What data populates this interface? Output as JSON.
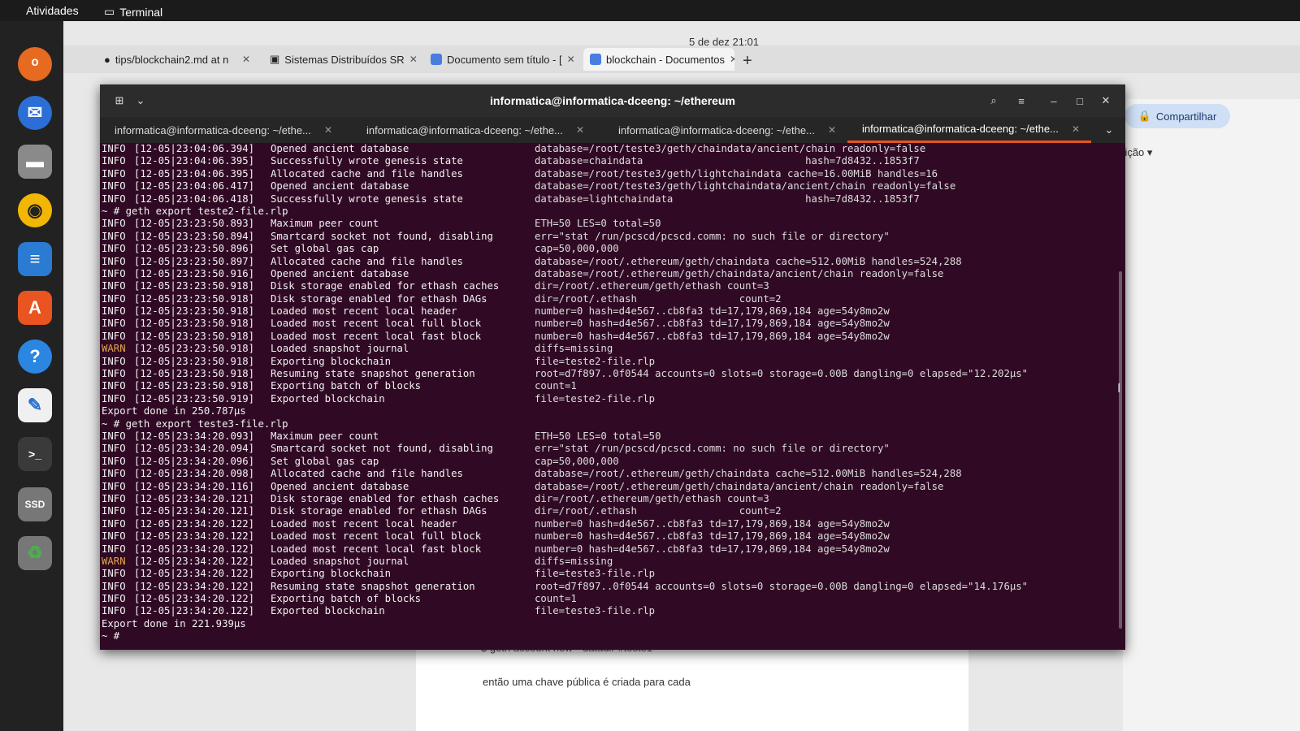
{
  "topbar": {
    "activities": "Atividades",
    "app": "Terminal",
    "clock": "5 de dez  21:01"
  },
  "browser": {
    "tabs": [
      {
        "label": "tips/blockchain2.md at n",
        "active": false
      },
      {
        "label": "Sistemas Distribuídos SR",
        "active": false
      },
      {
        "label": "Documento sem título - [",
        "active": false
      },
      {
        "label": "blockchain - Documentos",
        "active": true
      }
    ],
    "share_label": "Compartilhar",
    "edit_label": "Edição",
    "doc_line1": "$ geth account new --datadir ./teste1",
    "doc_line2": "então uma chave pública é criada para cada"
  },
  "terminal": {
    "title": "informatica@informatica-dceeng: ~/ethereum",
    "tabs": [
      {
        "label": "informatica@informatica-dceeng: ~/ethe...",
        "active": false
      },
      {
        "label": "informatica@informatica-dceeng: ~/ethe...",
        "active": false
      },
      {
        "label": "informatica@informatica-dceeng: ~/ethe...",
        "active": false
      },
      {
        "label": "informatica@informatica-dceeng: ~/ethe...",
        "active": true
      }
    ],
    "lines": [
      {
        "lvl": "INFO",
        "ts": "[12-05|23:04:06.394]",
        "msg": "Opened ancient database",
        "ctx": "database=/root/teste3/geth/chaindata/ancient/chain readonly=false"
      },
      {
        "lvl": "INFO",
        "ts": "[12-05|23:04:06.395]",
        "msg": "Successfully wrote genesis state",
        "ctx": "database=chaindata                           hash=7d8432..1853f7"
      },
      {
        "lvl": "INFO",
        "ts": "[12-05|23:04:06.395]",
        "msg": "Allocated cache and file handles",
        "ctx": "database=/root/teste3/geth/lightchaindata cache=16.00MiB handles=16"
      },
      {
        "lvl": "INFO",
        "ts": "[12-05|23:04:06.417]",
        "msg": "Opened ancient database",
        "ctx": "database=/root/teste3/geth/lightchaindata/ancient/chain readonly=false"
      },
      {
        "lvl": "INFO",
        "ts": "[12-05|23:04:06.418]",
        "msg": "Successfully wrote genesis state",
        "ctx": "database=lightchaindata                      hash=7d8432..1853f7"
      },
      {
        "plain": "~ # geth export teste2-file.rlp"
      },
      {
        "lvl": "INFO",
        "ts": "[12-05|23:23:50.893]",
        "msg": "Maximum peer count",
        "ctx": "ETH=50 LES=0 total=50"
      },
      {
        "lvl": "INFO",
        "ts": "[12-05|23:23:50.894]",
        "msg": "Smartcard socket not found, disabling",
        "ctx": "err=\"stat /run/pcscd/pcscd.comm: no such file or directory\""
      },
      {
        "lvl": "INFO",
        "ts": "[12-05|23:23:50.896]",
        "msg": "Set global gas cap",
        "ctx": "cap=50,000,000"
      },
      {
        "lvl": "INFO",
        "ts": "[12-05|23:23:50.897]",
        "msg": "Allocated cache and file handles",
        "ctx": "database=/root/.ethereum/geth/chaindata cache=512.00MiB handles=524,288"
      },
      {
        "lvl": "INFO",
        "ts": "[12-05|23:23:50.916]",
        "msg": "Opened ancient database",
        "ctx": "database=/root/.ethereum/geth/chaindata/ancient/chain readonly=false"
      },
      {
        "lvl": "INFO",
        "ts": "[12-05|23:23:50.918]",
        "msg": "Disk storage enabled for ethash caches",
        "ctx": "dir=/root/.ethereum/geth/ethash count=3"
      },
      {
        "lvl": "INFO",
        "ts": "[12-05|23:23:50.918]",
        "msg": "Disk storage enabled for ethash DAGs",
        "ctx": "dir=/root/.ethash                 count=2"
      },
      {
        "lvl": "INFO",
        "ts": "[12-05|23:23:50.918]",
        "msg": "Loaded most recent local header",
        "ctx": "number=0 hash=d4e567..cb8fa3 td=17,179,869,184 age=54y8mo2w"
      },
      {
        "lvl": "INFO",
        "ts": "[12-05|23:23:50.918]",
        "msg": "Loaded most recent local full block",
        "ctx": "number=0 hash=d4e567..cb8fa3 td=17,179,869,184 age=54y8mo2w"
      },
      {
        "lvl": "INFO",
        "ts": "[12-05|23:23:50.918]",
        "msg": "Loaded most recent local fast block",
        "ctx": "number=0 hash=d4e567..cb8fa3 td=17,179,869,184 age=54y8mo2w"
      },
      {
        "lvl": "WARN",
        "ts": "[12-05|23:23:50.918]",
        "msg": "Loaded snapshot journal",
        "ctx": "diffs=missing"
      },
      {
        "lvl": "INFO",
        "ts": "[12-05|23:23:50.918]",
        "msg": "Exporting blockchain",
        "ctx": "file=teste2-file.rlp"
      },
      {
        "lvl": "INFO",
        "ts": "[12-05|23:23:50.918]",
        "msg": "Resuming state snapshot generation",
        "ctx": "root=d7f897..0f0544 accounts=0 slots=0 storage=0.00B dangling=0 elapsed=\"12.202µs\""
      },
      {
        "lvl": "INFO",
        "ts": "[12-05|23:23:50.918]",
        "msg": "Exporting batch of blocks",
        "ctx": "count=1"
      },
      {
        "lvl": "INFO",
        "ts": "[12-05|23:23:50.919]",
        "msg": "Exported blockchain",
        "ctx": "file=teste2-file.rlp"
      },
      {
        "plain": "Export done in 250.787µs"
      },
      {
        "plain": "~ # geth export teste3-file.rlp"
      },
      {
        "lvl": "INFO",
        "ts": "[12-05|23:34:20.093]",
        "msg": "Maximum peer count",
        "ctx": "ETH=50 LES=0 total=50"
      },
      {
        "lvl": "INFO",
        "ts": "[12-05|23:34:20.094]",
        "msg": "Smartcard socket not found, disabling",
        "ctx": "err=\"stat /run/pcscd/pcscd.comm: no such file or directory\""
      },
      {
        "lvl": "INFO",
        "ts": "[12-05|23:34:20.096]",
        "msg": "Set global gas cap",
        "ctx": "cap=50,000,000"
      },
      {
        "lvl": "INFO",
        "ts": "[12-05|23:34:20.098]",
        "msg": "Allocated cache and file handles",
        "ctx": "database=/root/.ethereum/geth/chaindata cache=512.00MiB handles=524,288"
      },
      {
        "lvl": "INFO",
        "ts": "[12-05|23:34:20.116]",
        "msg": "Opened ancient database",
        "ctx": "database=/root/.ethereum/geth/chaindata/ancient/chain readonly=false"
      },
      {
        "lvl": "INFO",
        "ts": "[12-05|23:34:20.121]",
        "msg": "Disk storage enabled for ethash caches",
        "ctx": "dir=/root/.ethereum/geth/ethash count=3"
      },
      {
        "lvl": "INFO",
        "ts": "[12-05|23:34:20.121]",
        "msg": "Disk storage enabled for ethash DAGs",
        "ctx": "dir=/root/.ethash                 count=2"
      },
      {
        "lvl": "INFO",
        "ts": "[12-05|23:34:20.122]",
        "msg": "Loaded most recent local header",
        "ctx": "number=0 hash=d4e567..cb8fa3 td=17,179,869,184 age=54y8mo2w"
      },
      {
        "lvl": "INFO",
        "ts": "[12-05|23:34:20.122]",
        "msg": "Loaded most recent local full block",
        "ctx": "number=0 hash=d4e567..cb8fa3 td=17,179,869,184 age=54y8mo2w"
      },
      {
        "lvl": "INFO",
        "ts": "[12-05|23:34:20.122]",
        "msg": "Loaded most recent local fast block",
        "ctx": "number=0 hash=d4e567..cb8fa3 td=17,179,869,184 age=54y8mo2w"
      },
      {
        "lvl": "WARN",
        "ts": "[12-05|23:34:20.122]",
        "msg": "Loaded snapshot journal",
        "ctx": "diffs=missing"
      },
      {
        "lvl": "INFO",
        "ts": "[12-05|23:34:20.122]",
        "msg": "Exporting blockchain",
        "ctx": "file=teste3-file.rlp"
      },
      {
        "lvl": "INFO",
        "ts": "[12-05|23:34:20.122]",
        "msg": "Resuming state snapshot generation",
        "ctx": "root=d7f897..0f0544 accounts=0 slots=0 storage=0.00B dangling=0 elapsed=\"14.176µs\""
      },
      {
        "lvl": "INFO",
        "ts": "[12-05|23:34:20.122]",
        "msg": "Exporting batch of blocks",
        "ctx": "count=1"
      },
      {
        "lvl": "INFO",
        "ts": "[12-05|23:34:20.122]",
        "msg": "Exported blockchain",
        "ctx": "file=teste3-file.rlp"
      },
      {
        "plain": "Export done in 221.939µs"
      },
      {
        "plain": "~ # "
      }
    ]
  },
  "dock": [
    "firefox-icon",
    "thunderbird-icon",
    "files-icon",
    "rhythmbox-icon",
    "writer-icon",
    "app-center-icon",
    "help-icon",
    "text-editor-icon",
    "terminal-icon",
    "ssd-drive-icon",
    "trash-icon"
  ],
  "colors": {
    "terminal_bg": "#300a24",
    "accent": "#e95420",
    "warn": "#e0a64a"
  }
}
